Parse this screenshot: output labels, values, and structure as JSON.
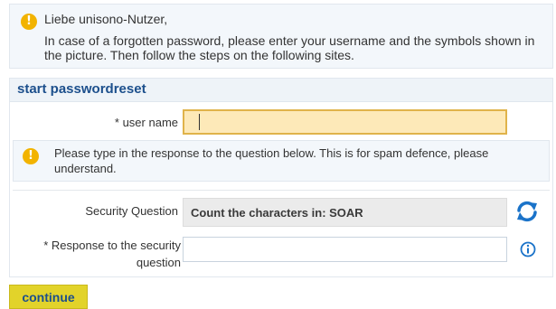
{
  "notice": {
    "icon": "warning-icon",
    "greeting": "Liebe unisono-Nutzer,",
    "message": "In case of a forgotten password, please enter your username and the symbols shown in the picture. Then follow the steps on the following sites."
  },
  "form": {
    "title": "start passwordreset",
    "username_label": "* user name",
    "username_value": "",
    "spam_notice": "Please type in the response to the question below. This is for spam defence, please understand.",
    "security_question_label": "Security Question",
    "security_question_value": "Count the characters in: SOAR",
    "refresh_icon": "refresh-icon",
    "response_label": "* Response to the security question",
    "response_value": "",
    "info_icon": "info-icon"
  },
  "actions": {
    "continue_label": "continue"
  },
  "colors": {
    "accent_blue": "#1c4f8c",
    "warning": "#f2b300",
    "button": "#e2d32a",
    "focus_input_bg": "#fde9b8"
  }
}
